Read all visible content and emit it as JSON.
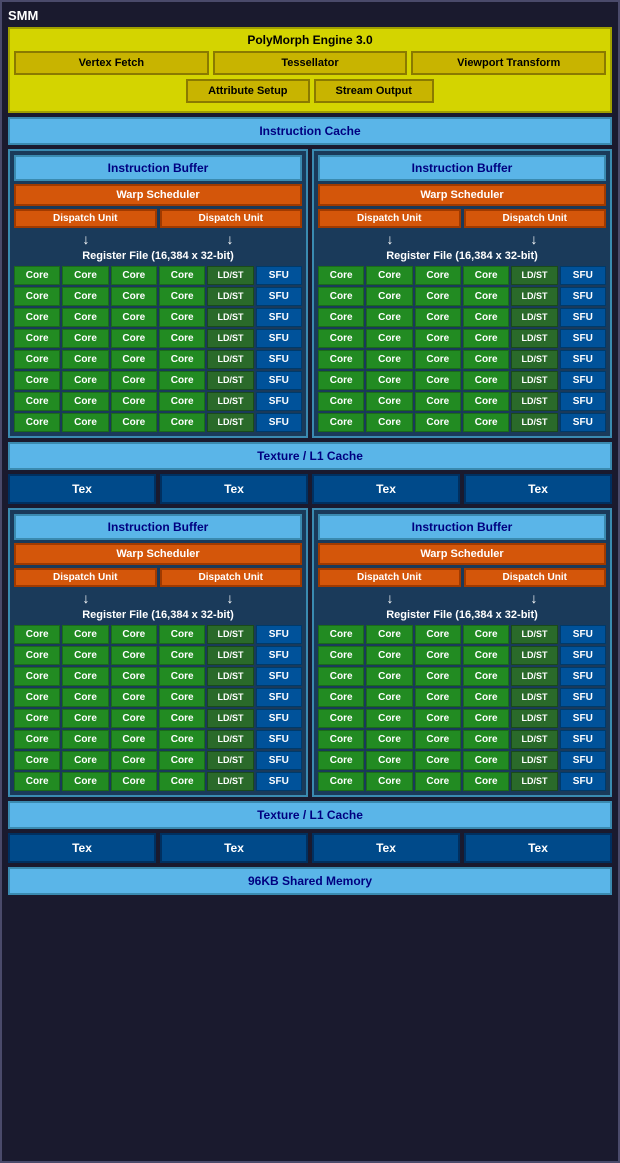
{
  "title": "SMM",
  "polymorph": {
    "title": "PolyMorph Engine 3.0",
    "row1": [
      "Vertex Fetch",
      "Tessellator",
      "Viewport Transform"
    ],
    "row2": [
      "Attribute Setup",
      "Stream Output"
    ]
  },
  "instruction_cache": "Instruction Cache",
  "sm_blocks": [
    {
      "instruction_buffer": "Instruction Buffer",
      "warp_scheduler": "Warp Scheduler",
      "dispatch_unit1": "Dispatch Unit",
      "dispatch_unit2": "Dispatch Unit",
      "register_file": "Register File (16,384 x 32-bit)",
      "rows": 8,
      "cores": [
        "Core",
        "Core",
        "Core",
        "Core"
      ],
      "ldst": "LD/ST",
      "sfu": "SFU"
    },
    {
      "instruction_buffer": "Instruction Buffer",
      "warp_scheduler": "Warp Scheduler",
      "dispatch_unit1": "Dispatch Unit",
      "dispatch_unit2": "Dispatch Unit",
      "register_file": "Register File (16,384 x 32-bit)",
      "rows": 8,
      "cores": [
        "Core",
        "Core",
        "Core",
        "Core"
      ],
      "ldst": "LD/ST",
      "sfu": "SFU"
    }
  ],
  "texture_cache": "Texture / L1 Cache",
  "tex_labels": [
    "Tex",
    "Tex",
    "Tex",
    "Tex"
  ],
  "sm_blocks2": [
    {
      "instruction_buffer": "Instruction Buffer",
      "warp_scheduler": "Warp Scheduler",
      "dispatch_unit1": "Dispatch Unit",
      "dispatch_unit2": "Dispatch Unit",
      "register_file": "Register File (16,384 x 32-bit)",
      "rows": 8,
      "cores": [
        "Core",
        "Core",
        "Core",
        "Core"
      ],
      "ldst": "LD/ST",
      "sfu": "SFU"
    },
    {
      "instruction_buffer": "Instruction Buffer",
      "warp_scheduler": "Warp Scheduler",
      "dispatch_unit1": "Dispatch Unit",
      "dispatch_unit2": "Dispatch Unit",
      "register_file": "Register File (16,384 x 32-bit)",
      "rows": 8,
      "cores": [
        "Core",
        "Core",
        "Core",
        "Core"
      ],
      "ldst": "LD/ST",
      "sfu": "SFU"
    }
  ],
  "texture_cache2": "Texture / L1 Cache",
  "tex_labels2": [
    "Tex",
    "Tex",
    "Tex",
    "Tex"
  ],
  "shared_memory": "96KB Shared Memory",
  "core_label": "Core",
  "ldst_label": "LD/ST",
  "sfu_label": "SFU"
}
